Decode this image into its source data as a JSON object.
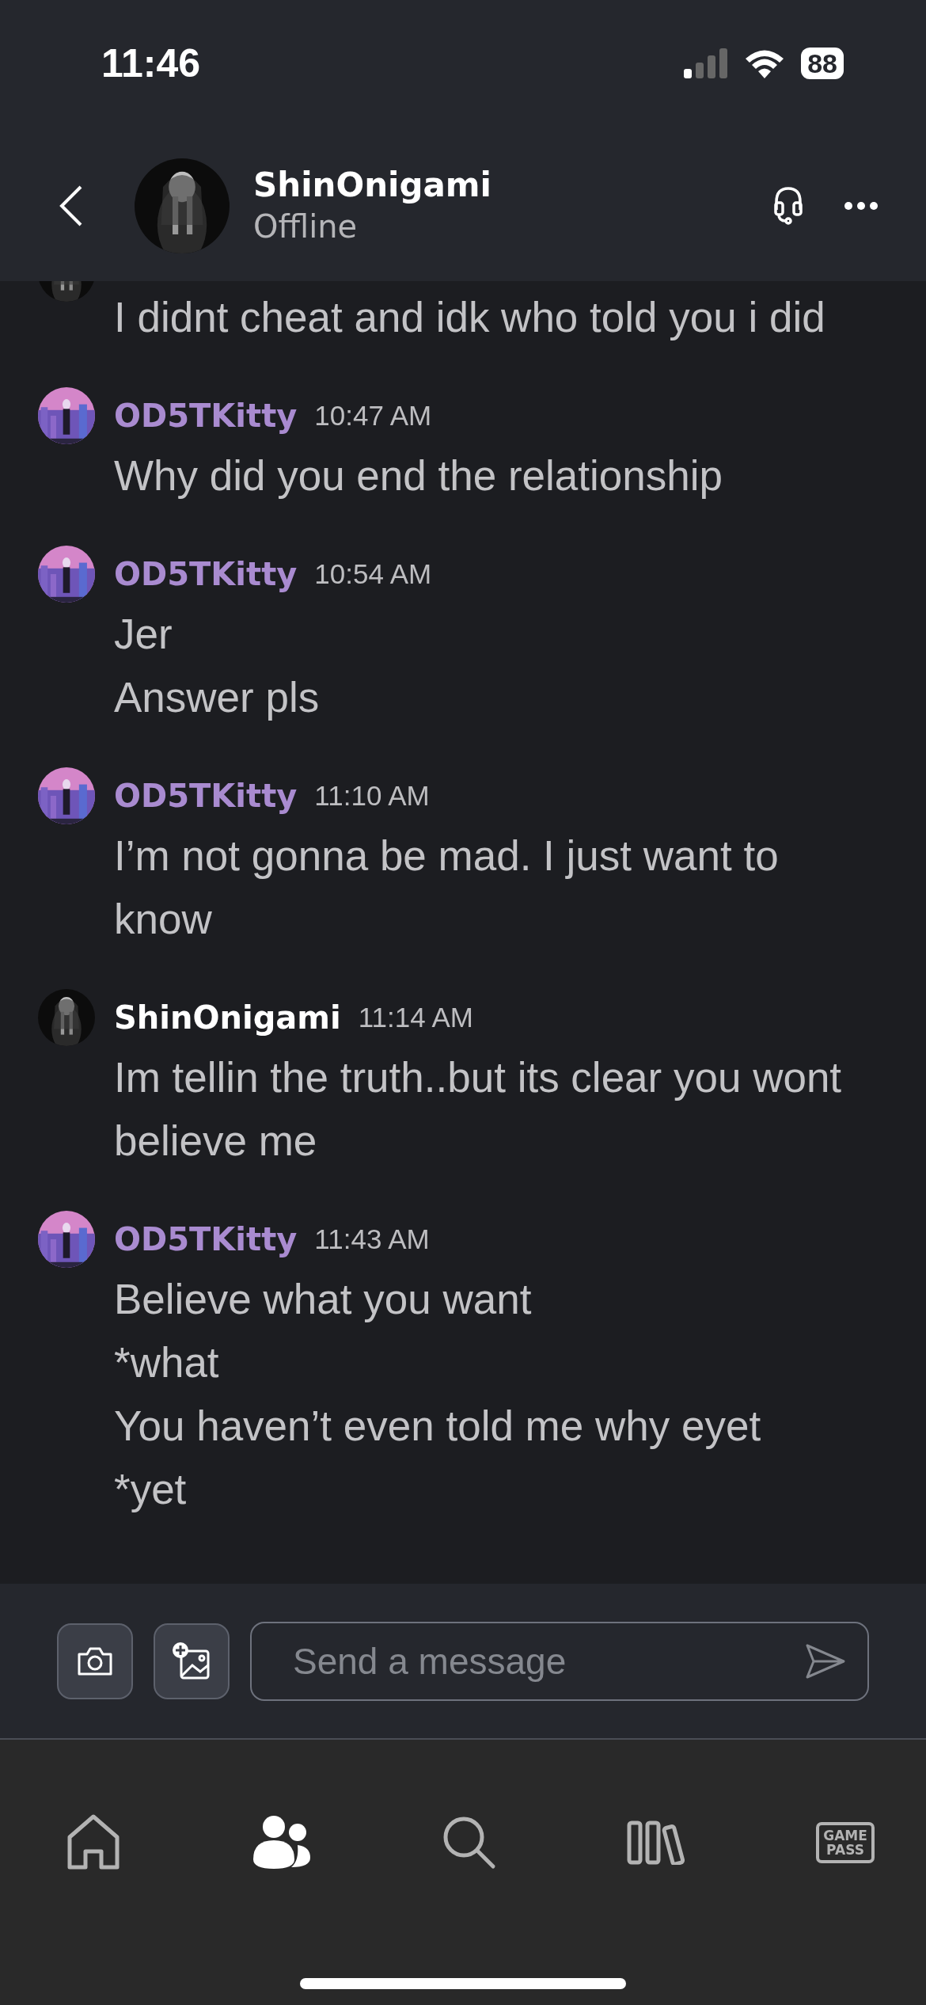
{
  "status_bar": {
    "time": "11:46",
    "battery": "88"
  },
  "header": {
    "name": "ShinOnigami",
    "status": "Offline"
  },
  "messages": [
    {
      "lines": [
        "I didnt cheat and idk who told you i did"
      ]
    },
    {
      "author": "OD5TKitty",
      "color": "#a98bd0",
      "time": "10:47 AM",
      "lines": [
        "Why did you end the relationship"
      ]
    },
    {
      "author": "OD5TKitty",
      "color": "#a98bd0",
      "time": "10:54 AM",
      "lines": [
        "Jer",
        "Answer pls"
      ]
    },
    {
      "author": "OD5TKitty",
      "color": "#a98bd0",
      "time": "11:10 AM",
      "lines": [
        "I’m not gonna be mad. I just want to know"
      ]
    },
    {
      "author": "ShinOnigami",
      "color": "#ffffff",
      "time": "11:14 AM",
      "lines": [
        "Im tellin the truth..but its clear you wont believe me"
      ]
    },
    {
      "author": "OD5TKitty",
      "color": "#a98bd0",
      "time": "11:43 AM",
      "lines": [
        "Believe what you want",
        "*what",
        "You haven’t even told me why eyet",
        "*yet"
      ]
    }
  ],
  "composer": {
    "placeholder": "Send a message"
  },
  "nav": [
    {
      "kind": "home",
      "selected": false
    },
    {
      "kind": "friends",
      "selected": true
    },
    {
      "kind": "search",
      "selected": false
    },
    {
      "kind": "library",
      "selected": false
    },
    {
      "kind": "gamepass",
      "label": "GAME PASS",
      "selected": false
    }
  ]
}
